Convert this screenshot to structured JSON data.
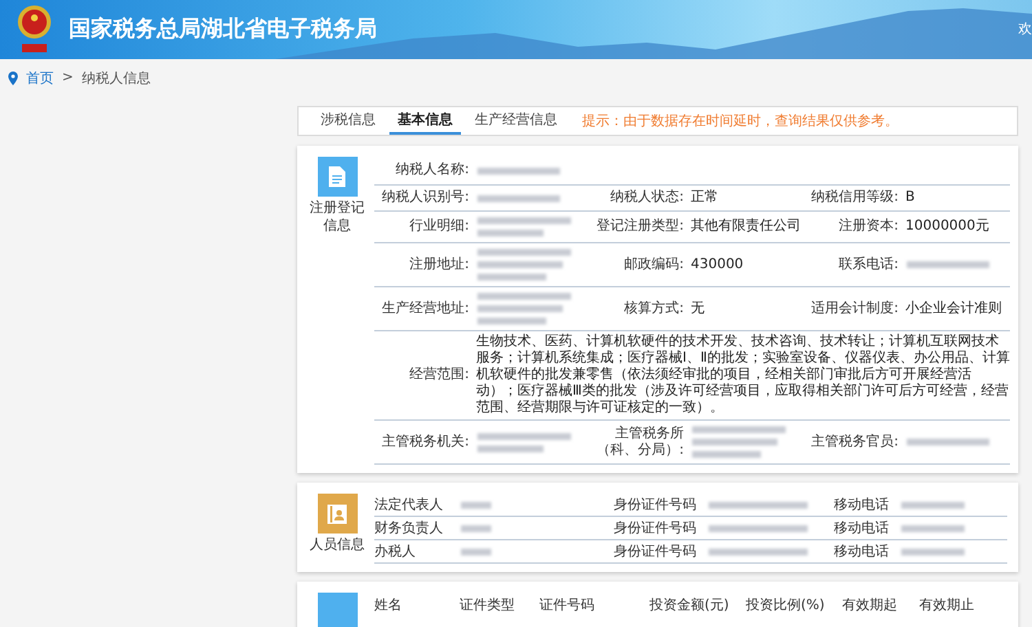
{
  "header": {
    "title": "国家税务总局湖北省电子税务局",
    "greeting": "欢"
  },
  "breadcrumb": {
    "home": "首页",
    "separator": ">",
    "current": "纳税人信息"
  },
  "tabs": [
    {
      "label": "涉税信息",
      "selected": false
    },
    {
      "label": "基本信息",
      "selected": true
    },
    {
      "label": "生产经营信息",
      "selected": false
    }
  ],
  "hint": "提示：由于数据存在时间延时，查询结果仅供参考。",
  "registration": {
    "title": "注册登记信息",
    "rows": [
      {
        "kind": "wide",
        "fields": [
          {
            "label": "纳税人名称:",
            "value": {
              "kind": "redacted_line"
            }
          }
        ]
      },
      {
        "kind": "triple",
        "fields": [
          {
            "label": "纳税人识别号:",
            "value": {
              "kind": "redacted_line"
            }
          },
          {
            "label": "纳税人状态:",
            "value": {
              "kind": "text",
              "text": "正常"
            }
          },
          {
            "label": "纳税信用等级:",
            "value": {
              "kind": "text",
              "text": "B"
            }
          }
        ]
      },
      {
        "kind": "triple",
        "fields": [
          {
            "label": "行业明细:",
            "value": {
              "kind": "redacted_pair"
            }
          },
          {
            "label": "登记注册类型:",
            "value": {
              "kind": "text",
              "text": "其他有限责任公司"
            }
          },
          {
            "label": "注册资本:",
            "value": {
              "kind": "text",
              "text": "10000000元"
            }
          }
        ]
      },
      {
        "kind": "triple",
        "fields": [
          {
            "label": "注册地址:",
            "value": {
              "kind": "redacted_block"
            }
          },
          {
            "label": "邮政编码:",
            "value": {
              "kind": "text",
              "text": "430000"
            }
          },
          {
            "label": "联系电话:",
            "value": {
              "kind": "redacted_line"
            }
          }
        ]
      },
      {
        "kind": "triple",
        "fields": [
          {
            "label": "生产经营地址:",
            "value": {
              "kind": "redacted_block"
            }
          },
          {
            "label": "核算方式:",
            "value": {
              "kind": "text",
              "text": "无"
            }
          },
          {
            "label": "适用会计制度:",
            "value": {
              "kind": "text",
              "text": "小企业会计准则"
            }
          }
        ]
      },
      {
        "kind": "wide",
        "fields": [
          {
            "label": "经营范围:",
            "value": {
              "kind": "text",
              "text": "生物技术、医药、计算机软硬件的技术开发、技术咨询、技术转让；计算机互联网技术服务；计算机系统集成；医疗器械Ⅰ、Ⅱ的批发；实验室设备、仪器仪表、办公用品、计算机软硬件的批发兼零售（依法须经审批的项目，经相关部门审批后方可开展经营活动）；医疗器械Ⅲ类的批发（涉及许可经营项目，应取得相关部门许可后方可经营，经营范围、经营期限与许可证核定的一致）。"
            }
          }
        ]
      },
      {
        "kind": "triple",
        "fields": [
          {
            "label": "主管税务机关:",
            "value": {
              "kind": "redacted_pair"
            }
          },
          {
            "label": "主管税务所（科、分局）:",
            "value": {
              "kind": "redacted_block"
            }
          },
          {
            "label": "主管税务官员:",
            "value": {
              "kind": "redacted_line"
            }
          }
        ]
      }
    ]
  },
  "personnel": {
    "title": "人员信息",
    "rows": [
      {
        "role": "法定代表人",
        "id_label": "身份证件号码",
        "phone_label": "移动电话"
      },
      {
        "role": "财务负责人",
        "id_label": "身份证件号码",
        "phone_label": "移动电话"
      },
      {
        "role": "办税人",
        "id_label": "身份证件号码",
        "phone_label": "移动电话"
      }
    ]
  },
  "investors": {
    "columns": [
      "姓名",
      "证件类型",
      "证件号码",
      "投资金额(元)",
      "投资比例(%)",
      "有效期起",
      "有效期止"
    ]
  }
}
